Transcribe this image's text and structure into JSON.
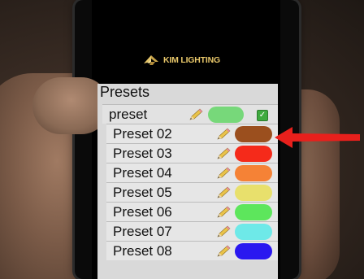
{
  "brand": {
    "logo_text": "KIM LIGHTING",
    "logo_color": "#e8c76a"
  },
  "presets": {
    "title": "Presets",
    "active": {
      "label": "preset",
      "color": "#77d87a",
      "checked": true,
      "check_glyph": "✓",
      "edit_icon": "pencil-icon"
    },
    "items": [
      {
        "label": "Preset 02",
        "color": "#9b4f1e",
        "edit_icon": "pencil-icon"
      },
      {
        "label": "Preset 03",
        "color": "#f52a1a",
        "edit_icon": "pencil-icon"
      },
      {
        "label": "Preset 04",
        "color": "#f58236",
        "edit_icon": "pencil-icon"
      },
      {
        "label": "Preset 05",
        "color": "#e8e06c",
        "edit_icon": "pencil-icon"
      },
      {
        "label": "Preset 06",
        "color": "#5de65c",
        "edit_icon": "pencil-icon"
      },
      {
        "label": "Preset 07",
        "color": "#6ee9e8",
        "edit_icon": "pencil-icon"
      },
      {
        "label": "Preset 08",
        "color": "#2a18f0",
        "edit_icon": "pencil-icon"
      }
    ]
  },
  "annotation": {
    "arrow_color": "#e8201c",
    "points_to": "Preset 02"
  }
}
